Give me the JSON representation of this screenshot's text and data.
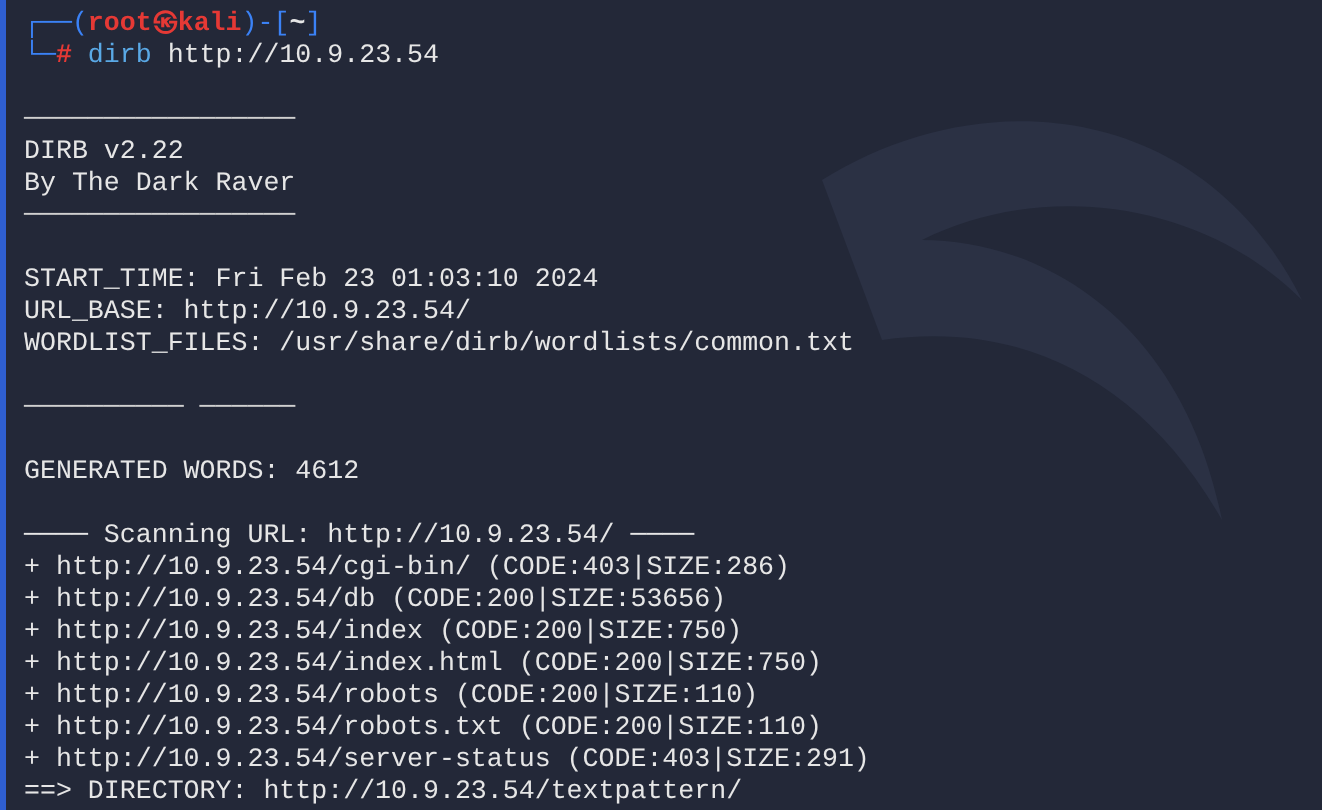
{
  "prompt": {
    "line1": [
      {
        "kind": "frame",
        "text": "┌──("
      },
      {
        "kind": "user",
        "text": "root㉿kali"
      },
      {
        "kind": "frame",
        "text": ")-["
      },
      {
        "kind": "dir",
        "text": "~"
      },
      {
        "kind": "frame",
        "text": "]"
      }
    ],
    "line2": [
      {
        "kind": "frame",
        "text": "└─"
      },
      {
        "kind": "hash",
        "text": "#"
      },
      {
        "kind": "command",
        "text": " dirb"
      },
      {
        "kind": "arg",
        "text": " http://10.9.23.54"
      }
    ]
  },
  "output": [
    {
      "kind": "blank"
    },
    {
      "kind": "rule",
      "text": "─────────────────"
    },
    {
      "kind": "text",
      "text": "DIRB v2.22"
    },
    {
      "kind": "text",
      "text": "By The Dark Raver"
    },
    {
      "kind": "rule",
      "text": "─────────────────"
    },
    {
      "kind": "blank"
    },
    {
      "kind": "text",
      "text": "START_TIME: Fri Feb 23 01:03:10 2024"
    },
    {
      "kind": "text",
      "text": "URL_BASE: http://10.9.23.54/"
    },
    {
      "kind": "text",
      "text": "WORDLIST_FILES: /usr/share/dirb/wordlists/common.txt"
    },
    {
      "kind": "blank"
    },
    {
      "kind": "rule",
      "text": "────────── ──────"
    },
    {
      "kind": "blank"
    },
    {
      "kind": "text",
      "text": "GENERATED WORDS: 4612"
    },
    {
      "kind": "blank"
    },
    {
      "kind": "text",
      "text": "──── Scanning URL: http://10.9.23.54/ ────"
    },
    {
      "kind": "text",
      "text": "+ http://10.9.23.54/cgi-bin/ (CODE:403|SIZE:286)"
    },
    {
      "kind": "text",
      "text": "+ http://10.9.23.54/db (CODE:200|SIZE:53656)"
    },
    {
      "kind": "text",
      "text": "+ http://10.9.23.54/index (CODE:200|SIZE:750)"
    },
    {
      "kind": "text",
      "text": "+ http://10.9.23.54/index.html (CODE:200|SIZE:750)"
    },
    {
      "kind": "text",
      "text": "+ http://10.9.23.54/robots (CODE:200|SIZE:110)"
    },
    {
      "kind": "text",
      "text": "+ http://10.9.23.54/robots.txt (CODE:200|SIZE:110)"
    },
    {
      "kind": "text",
      "text": "+ http://10.9.23.54/server-status (CODE:403|SIZE:291)"
    },
    {
      "kind": "text",
      "text": "==> DIRECTORY: http://10.9.23.54/textpattern/"
    }
  ]
}
